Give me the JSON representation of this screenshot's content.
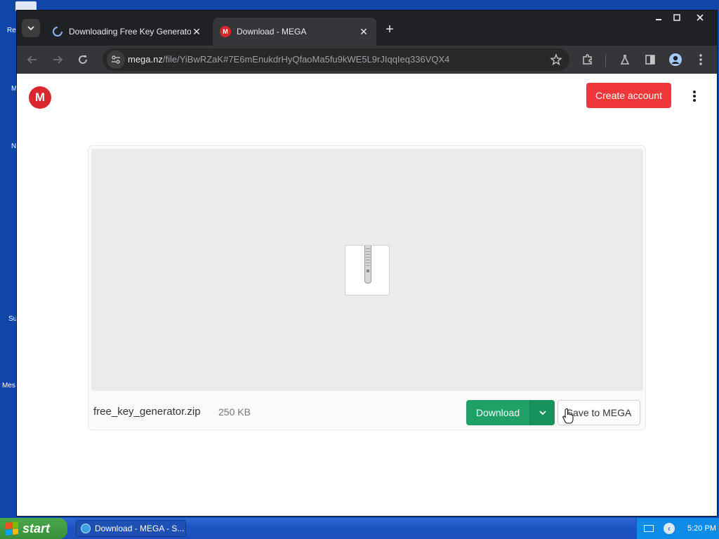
{
  "desktop": {
    "labels": [
      "Re",
      "M",
      "N",
      "Su",
      "Mes"
    ]
  },
  "browser": {
    "tabs": [
      {
        "title": "Downloading Free Key Generator (",
        "icon": "loading-spinner-icon",
        "active": false
      },
      {
        "title": "Download - MEGA",
        "icon": "mega-favicon",
        "active": true
      }
    ],
    "url_host": "mega.nz",
    "url_path": "/file/YiBwRZaK#7E6mEnukdrHyQfaoMa5fu9kWE5L9rJIqqIeq336VQX4"
  },
  "page": {
    "logo_letter": "M",
    "create_account_label": "Create account",
    "file": {
      "name": "free_key_generator.zip",
      "size": "250 KB"
    },
    "download_label": "Download",
    "save_label": "Save to MEGA"
  },
  "colors": {
    "mega_red": "#d9272e",
    "create_button": "#f0373a",
    "download_green": "#1ea066"
  },
  "taskbar": {
    "start_label": "start",
    "task_label": "Download - MEGA - S...",
    "clock": "5:20 PM"
  }
}
